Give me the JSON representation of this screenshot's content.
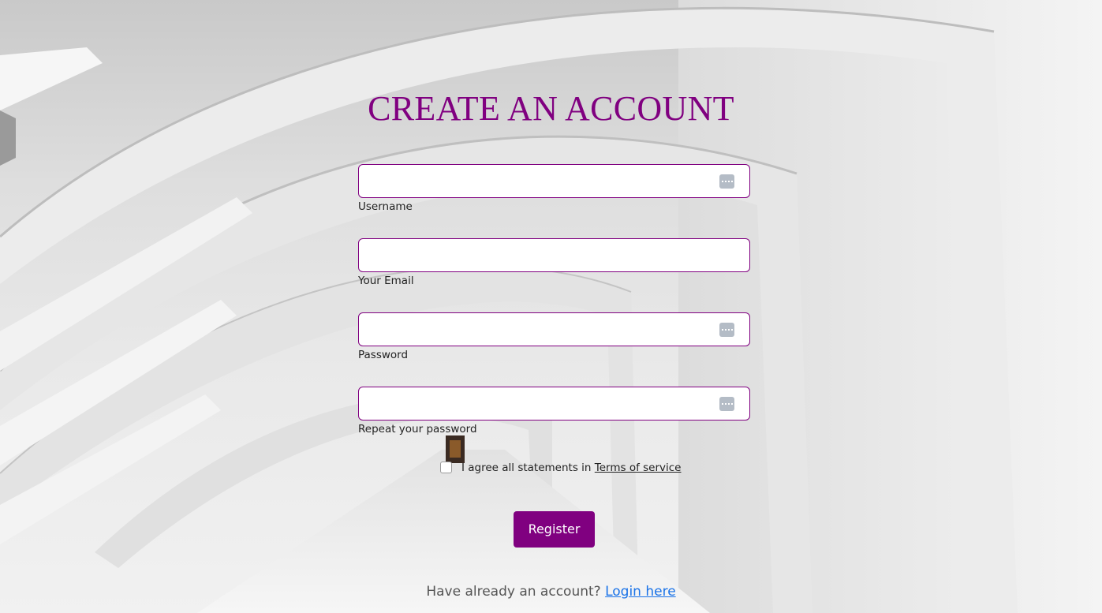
{
  "page": {
    "title": "CREATE AN ACCOUNT",
    "accent_color": "#800080",
    "link_color": "#1a73e8"
  },
  "form": {
    "fields": [
      {
        "label": "Username",
        "value": "",
        "type": "text",
        "has_autofill_icon": true
      },
      {
        "label": "Your Email",
        "value": "",
        "type": "email",
        "has_autofill_icon": false
      },
      {
        "label": "Password",
        "value": "",
        "type": "password",
        "has_autofill_icon": true
      },
      {
        "label": "Repeat your password",
        "value": "",
        "type": "password",
        "has_autofill_icon": true
      }
    ],
    "agree_text": "I agree all statements in",
    "terms_link": "Terms of service",
    "agree_checked": false,
    "register_label": "Register",
    "login_prompt": "Have already an account?",
    "login_link": "Login here"
  }
}
